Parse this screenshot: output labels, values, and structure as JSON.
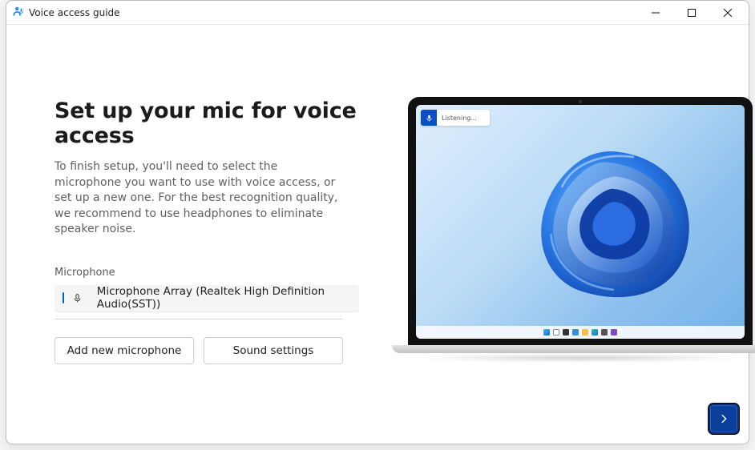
{
  "window": {
    "title": "Voice access guide"
  },
  "main": {
    "heading": "Set up your mic for voice access",
    "paragraph": "To finish setup, you'll need to select the microphone you want to use with voice access, or set up a new one. For the best recognition quality, we recommend to use headphones to eliminate speaker noise.",
    "microphone_label": "Microphone",
    "selected_microphone": "Microphone Array (Realtek High Definition Audio(SST))",
    "buttons": {
      "add_new_microphone": "Add new microphone",
      "sound_settings": "Sound settings"
    }
  },
  "illustration": {
    "voice_access_bar_status": "Listening..."
  },
  "window_controls": {
    "minimize": "Minimize",
    "maximize": "Maximize",
    "close": "Close"
  },
  "nav": {
    "next": "Next"
  }
}
